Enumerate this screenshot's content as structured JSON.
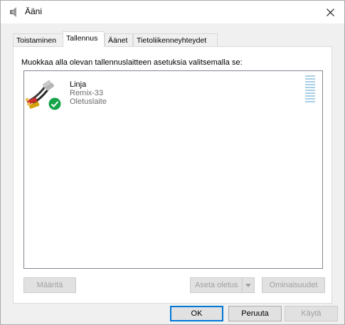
{
  "window": {
    "title": "Ääni"
  },
  "tabs": [
    {
      "label": "Toistaminen",
      "active": false
    },
    {
      "label": "Tallennus",
      "active": true
    },
    {
      "label": "Äänet",
      "active": false
    },
    {
      "label": "Tietoliikenneyhteydet",
      "active": false
    }
  ],
  "panel": {
    "instruction": "Muokkaa alla olevan tallennuslaitteen asetuksia valitsemalla se:",
    "device": {
      "name": "Linja",
      "model": "Remix-33",
      "status": "Oletuslaite",
      "icon": "rca-cable-icon",
      "status_icon": "green-check-icon"
    },
    "buttons": {
      "configure": "Määritä",
      "set_default": "Aseta oletus",
      "properties": "Ominaisuudet"
    }
  },
  "footer": {
    "ok": "OK",
    "cancel": "Peruuta",
    "apply": "Käytä"
  },
  "colors": {
    "accent": "#0078d7",
    "check": "#16a34a",
    "meter": "#a9cfe7"
  }
}
